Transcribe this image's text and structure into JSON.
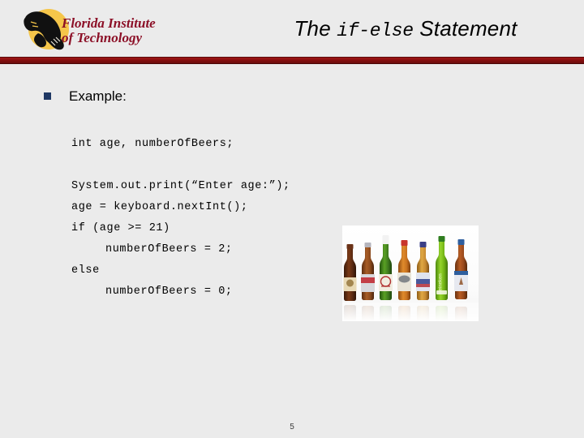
{
  "slide": {
    "background_color": "#ebebeb",
    "accent_rule_color": "#8c1111"
  },
  "header": {
    "logo": {
      "name": "florida-institute-of-technology-logo",
      "line1": "Florida Institute",
      "line2": "of Technology",
      "mark": "panther-head",
      "text_color": "#8c1027",
      "disc_color": "#f5c64a"
    },
    "title": {
      "prefix": "The ",
      "mono": "if-else",
      "suffix": " Statement",
      "full": "The if-else Statement"
    }
  },
  "content": {
    "bullet": {
      "marker": "square-bullet",
      "marker_color": "#1f3864",
      "label": "Example:"
    },
    "code_lines": [
      {
        "text": "int age, numberOfBeers;",
        "indent": false
      },
      {
        "text": "",
        "indent": false
      },
      {
        "text": "System.out.print(“Enter age:”);",
        "indent": false
      },
      {
        "text": "age = keyboard.nextInt();",
        "indent": false
      },
      {
        "text": "if (age >= 21)",
        "indent": false
      },
      {
        "text": "numberOfBeers = 2;",
        "indent": true
      },
      {
        "text": "else",
        "indent": false
      },
      {
        "text": "numberOfBeers = 0;",
        "indent": true
      }
    ]
  },
  "image": {
    "name": "beer-bottles-photo",
    "description": "Row of seven beer bottles with reflections on white background",
    "bottles": [
      {
        "body_color": "#5b2a12",
        "cap_color": "#6b3318",
        "label_color": "#e8d9b5"
      },
      {
        "body_color": "#8c4a1d",
        "cap_color": "#b5b5bd",
        "label_color": "#d8d8dc"
      },
      {
        "body_color": "#3f7a1e",
        "cap_color": "#f0f0f0",
        "label_color": "#f1ece0"
      },
      {
        "body_color": "#c9721f",
        "cap_color": "#c8352b",
        "label_color": "#e9e4d8"
      },
      {
        "body_color": "#c98c33",
        "cap_color": "#3b3f86",
        "label_color": "#dfe3ef"
      },
      {
        "body_color": "#72b414",
        "cap_color": "#2f7d1f",
        "label_color": "#8cc62a"
      },
      {
        "body_color": "#9a4a1c",
        "cap_color": "#2f5f9e",
        "label_color": "#e7e9f0"
      }
    ]
  },
  "footer": {
    "page_number": "5"
  }
}
